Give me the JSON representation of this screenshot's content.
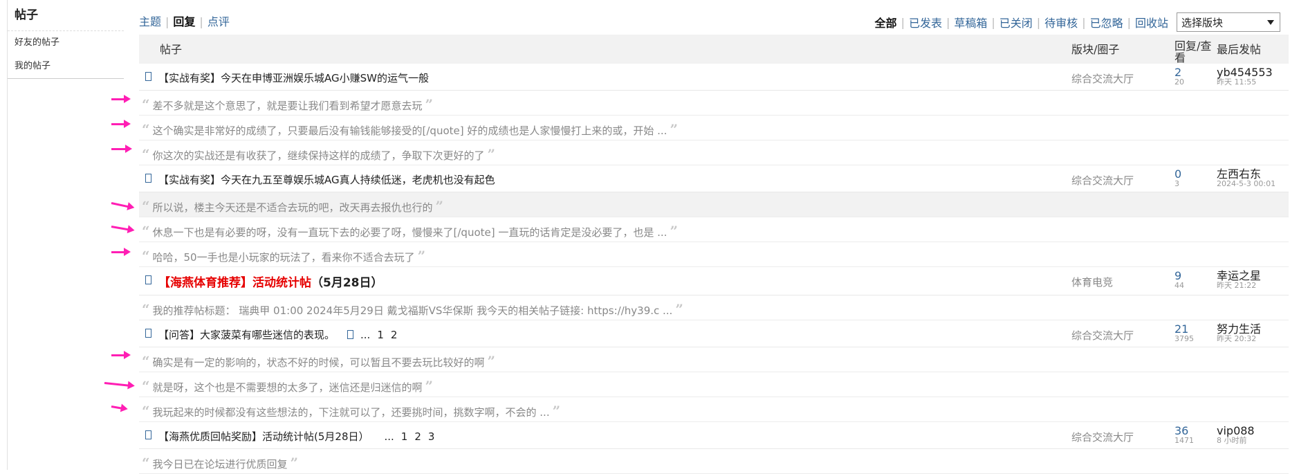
{
  "sidebar": {
    "title": "帖子",
    "items": [
      {
        "label": "好友的帖子"
      },
      {
        "label": "我的帖子"
      }
    ]
  },
  "tabs_left": [
    "主题",
    "回复",
    "点评"
  ],
  "tabs_left_active": "回复",
  "tabs_right": [
    "全部",
    "已发表",
    "草稿箱",
    "已关闭",
    "待审核",
    "已忽略",
    "回收站"
  ],
  "tabs_right_active": "全部",
  "forum_select": "选择版块",
  "table_header": {
    "post": "帖子",
    "forum": "版块/圈子",
    "replies_views": "回复/查看",
    "last_post": "最后发帖"
  },
  "quote_open": "“",
  "quote_close": "”",
  "threads": [
    {
      "title": "【实战有奖】今天在申博亚洲娱乐城AG小赚SW的运气一般",
      "forum": "综合交流大厅",
      "replies": "2",
      "views": "20",
      "last_author": "yb454553",
      "last_time": "昨天 11:55",
      "quotes": [
        "差不多就是这个意思了，就是要让我们看到希望才愿意去玩",
        "这个确实是非常好的成绩了，只要最后没有输钱能够接受的[/quote] 好的成绩也是人家慢慢打上来的或，开始 ...",
        "你这次的实战还是有收获了，继续保持这样的成绩了，争取下次更好的了"
      ]
    },
    {
      "title": "【实战有奖】今天在九五至尊娱乐城AG真人持续低迷，老虎机也没有起色",
      "forum": "综合交流大厅",
      "replies": "0",
      "views": "3",
      "last_author": "左西右东",
      "last_time": "2024-5-3 00:01",
      "quotes": [
        "所以说，楼主今天还是不适合去玩的吧，改天再去报仇也行的",
        "休息一下也是有必要的呀，没有一直玩下去的必要了呀，慢慢来了[/quote] 一直玩的话肯定是没必要了，也是 ...",
        "哈哈，50一手也是小玩家的玩法了，看来你不适合去玩了"
      ]
    },
    {
      "title_red": "【海燕体育推荐】活动统计帖",
      "title_rest": "（5月28日）",
      "forum": "体育电竞",
      "replies": "9",
      "views": "44",
      "last_author": "幸运之星",
      "last_time": "昨天 21:22",
      "quotes": [
        "我的推荐帖标题： 瑞典甲 01:00 2024年5月29日 戴戈福斯VS华保斯 我今天的相关帖子链接: https://hy39.c ..."
      ]
    },
    {
      "title": "【问答】大家菠菜有哪些迷信的表现。",
      "pages": [
        "...",
        "1",
        "2"
      ],
      "forum": "综合交流大厅",
      "replies": "21",
      "views": "3795",
      "last_author": "努力生活",
      "last_time": "昨天 20:32",
      "quotes": [
        "确实是有一定的影响的，状态不好的时候，可以暂且不要去玩比较好的啊",
        "就是呀，这个也是不需要想的太多了，迷信还是归迷信的啊",
        "我玩起来的时候都没有这些想法的，下注就可以了，还要挑时间，挑数字啊，不会的 ..."
      ]
    },
    {
      "title": "【海燕优质回帖奖励】活动统计帖(5月28日）",
      "pages": [
        "...",
        "1",
        "2",
        "3"
      ],
      "forum": "综合交流大厅",
      "replies": "36",
      "views": "1471",
      "last_author": "vip088",
      "last_time": "8 小时前",
      "quotes": [
        "我今日已在论坛进行优质回复"
      ]
    }
  ],
  "annotation_color": "#ff1eb4"
}
